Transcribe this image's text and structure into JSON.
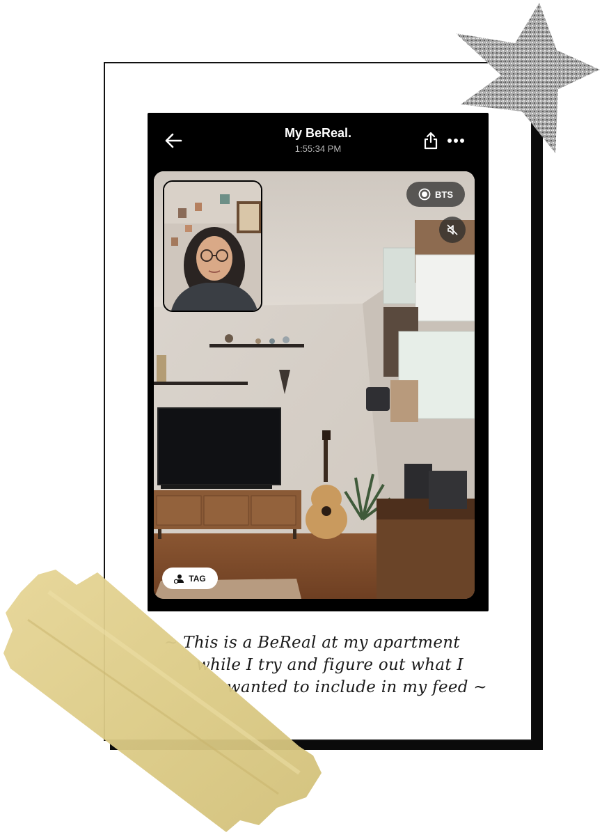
{
  "header": {
    "title": "My BeReal.",
    "time": "1:55:34 PM"
  },
  "photo": {
    "bts_label": "BTS",
    "tag_label": "TAG"
  },
  "caption": {
    "line1": "~ This is a BeReal at my apartment",
    "line2": "while I try and figure out what I",
    "line3": "wanted to include in my feed ~"
  },
  "icons": [
    "back-arrow-icon",
    "share-icon",
    "more-icon",
    "bts-record-icon",
    "mute-icon",
    "tag-person-icon",
    "star-sticker",
    "tape-sticker"
  ]
}
